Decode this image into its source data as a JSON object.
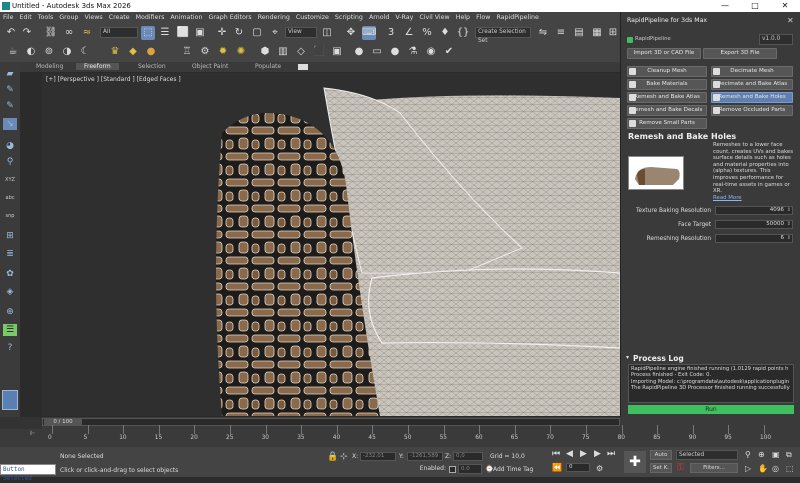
{
  "window": {
    "title": "Untitled - Autodesk 3ds Max 2026",
    "minimize": "—",
    "maximize": "□",
    "close": "✕"
  },
  "menu": [
    "File",
    "Edit",
    "Tools",
    "Group",
    "Views",
    "Create",
    "Modifiers",
    "Animation",
    "Graph Editors",
    "Rendering",
    "Customize",
    "Scripting",
    "Arnold",
    "V-Ray",
    "Civil View",
    "Help",
    "Flow",
    "RapidPipeline"
  ],
  "toolbar": {
    "selection_filter": "All",
    "ref_coord": "View",
    "selection_set": "Create Selection Set"
  },
  "ribbon_tabs": [
    "Modeling",
    "Freeform",
    "Selection",
    "Object Paint",
    "Populate"
  ],
  "ribbon_active": "Freeform",
  "viewport": {
    "label": "[+] [Perspective ] [Standard ] [Edged Faces ]"
  },
  "panel": {
    "title": "RapidPipeline for 3ds Max",
    "brand": "RapidPipeline",
    "version": "v1.0.0",
    "import_btn": "Import 3D or CAD File",
    "export_btn": "Export 3D File",
    "buttons": [
      "Cleanup Mesh",
      "Decimate Mesh",
      "Bake Materials",
      "Decimate and Bake Atlas",
      "Remesh and Bake Atlas",
      "Remesh and Bake Holes",
      "Remesh and Bake Decals",
      "Remove Occluded Parts",
      "Remove Small Parts"
    ],
    "section_title": "Remesh and Bake Holes",
    "description": "Remeshes to a lower face count, creates UVs and bakes surface details such as holes and material properties into (alpha) textures. This improves performance for real-time assets in games or XR.",
    "read_more": "Read More",
    "params": [
      {
        "label": "Texture Baking Resolution",
        "value": "4096"
      },
      {
        "label": "Face Target",
        "value": "50000"
      },
      {
        "label": "Remeshing Resolution",
        "value": "6"
      }
    ],
    "log_title": "Process Log",
    "log_lines": [
      "RapidPipeline engine finished running (1.0129 rapid points h",
      "Process finished - Exit Code: 0.",
      "Importing Model: c:\\programdata\\autodesk\\applicationplugin",
      "The RapidPipeline 3D Processor finished running successfully"
    ],
    "run": "Run"
  },
  "timeline": {
    "frame": "0 / 100",
    "ticks": [
      "0",
      "5",
      "10",
      "15",
      "20",
      "25",
      "30",
      "35",
      "40",
      "45",
      "50",
      "55",
      "60",
      "65",
      "70",
      "75",
      "80",
      "85",
      "90",
      "95",
      "100"
    ]
  },
  "status": {
    "script_btn": "Button Selected",
    "none_selected": "None Selected",
    "hint": "Click or click-and-drag to select objects",
    "x_label": "X:",
    "x": "-232,01",
    "y_label": "Y:",
    "y": "-1261,589",
    "z_label": "Z:",
    "z": "0,0",
    "grid": "Grid = 10,0",
    "enabled": "Enabled:",
    "add_time_tag": "Add Time Tag",
    "auto": "Auto",
    "selected": "Selected",
    "set_k": "Set K.",
    "filters": "Filters...",
    "frame": "0"
  },
  "colors": {
    "accent": "#5e7fb0",
    "run": "#3fbf5f",
    "panel": "#3a3a3a"
  }
}
